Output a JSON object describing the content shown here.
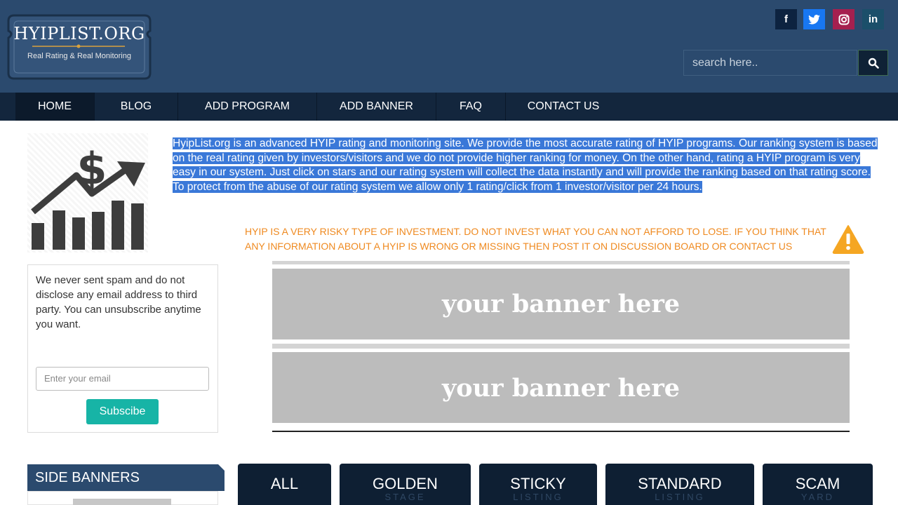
{
  "header": {
    "logo_title": "HYIPLIST.ORG",
    "logo_subtitle": "Real Rating & Real Monitoring",
    "social": [
      {
        "icon": "facebook-icon",
        "glyph": "f"
      },
      {
        "icon": "twitter-icon",
        "glyph": "🐦"
      },
      {
        "icon": "instagram-icon",
        "glyph": "◎"
      },
      {
        "icon": "linkedin-icon",
        "glyph": "in"
      }
    ],
    "search_placeholder": "search here.."
  },
  "nav": {
    "items": [
      {
        "label": "HOME",
        "active": true
      },
      {
        "label": "BLOG"
      },
      {
        "label": "ADD PROGRAM"
      },
      {
        "label": "ADD BANNER"
      },
      {
        "label": "FAQ"
      },
      {
        "label": "CONTACT US"
      }
    ]
  },
  "intro_text": "HyipList.org is an advanced HYIP rating and monitoring site. We provide the most accurate rating of HYIP programs. Our ranking system is based on the real rating given by investors/visitors and we do not provide higher ranking for money. On the other hand, rating a HYIP program is very easy in our system. Just click on stars and our rating system will collect the data instantly and will provide the ranking based on that rating score. To protect from the abuse of our rating system we allow only 1 rating/click from 1 investor/visitor per 24 hours.",
  "warning_text": "HYIP IS A VERY RISKY TYPE OF INVESTMENT. DO NOT INVEST WHAT YOU CAN NOT AFFORD TO LOSE. IF YOU THINK THAT ANY INFORMATION ABOUT A HYIP IS WRONG OR MISSING THEN POST IT ON DISCUSSION BOARD OR CONTACT US",
  "banners": [
    "your banner here",
    "your banner here"
  ],
  "newsletter": {
    "text": "We never sent spam and do not disclose any email address to third party. You can unsubscribe anytime you want.",
    "email_placeholder": "Enter your email",
    "button_label": "Subscibe"
  },
  "side_banners_title": "SIDE BANNERS",
  "tabs": [
    {
      "label": "ALL",
      "sub": ""
    },
    {
      "label": "GOLDEN",
      "sub": "STAGE"
    },
    {
      "label": "STICKY",
      "sub": "LISTING"
    },
    {
      "label": "STANDARD",
      "sub": "LISTING"
    },
    {
      "label": "SCAM",
      "sub": "YARD"
    }
  ],
  "colors": {
    "header_bg": "#2b4a6e",
    "nav_bg": "#13263d",
    "accent_teal": "#17b4a6",
    "warning_orange": "#ef8a20",
    "selection_blue": "#3a78d8"
  }
}
